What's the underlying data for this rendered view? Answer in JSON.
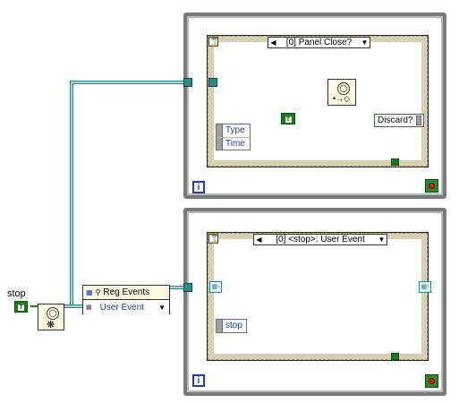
{
  "stop_label": "stop",
  "bool_const": "T",
  "top_event": {
    "case_label": "[0] Panel Close?",
    "unbundle": [
      "Type",
      "Time"
    ],
    "discard": "Discard?",
    "iteration": "i"
  },
  "bottom_event": {
    "case_label": "[0] <stop>: User Event",
    "stop_item": "stop",
    "iteration": "i"
  },
  "reg_events": {
    "title": "Reg Events",
    "selector": "User Event"
  },
  "colors": {
    "wire_ref": "#2e8a8a",
    "wire_bool": "#1a7a1a",
    "frame": "#7a7a7a"
  }
}
